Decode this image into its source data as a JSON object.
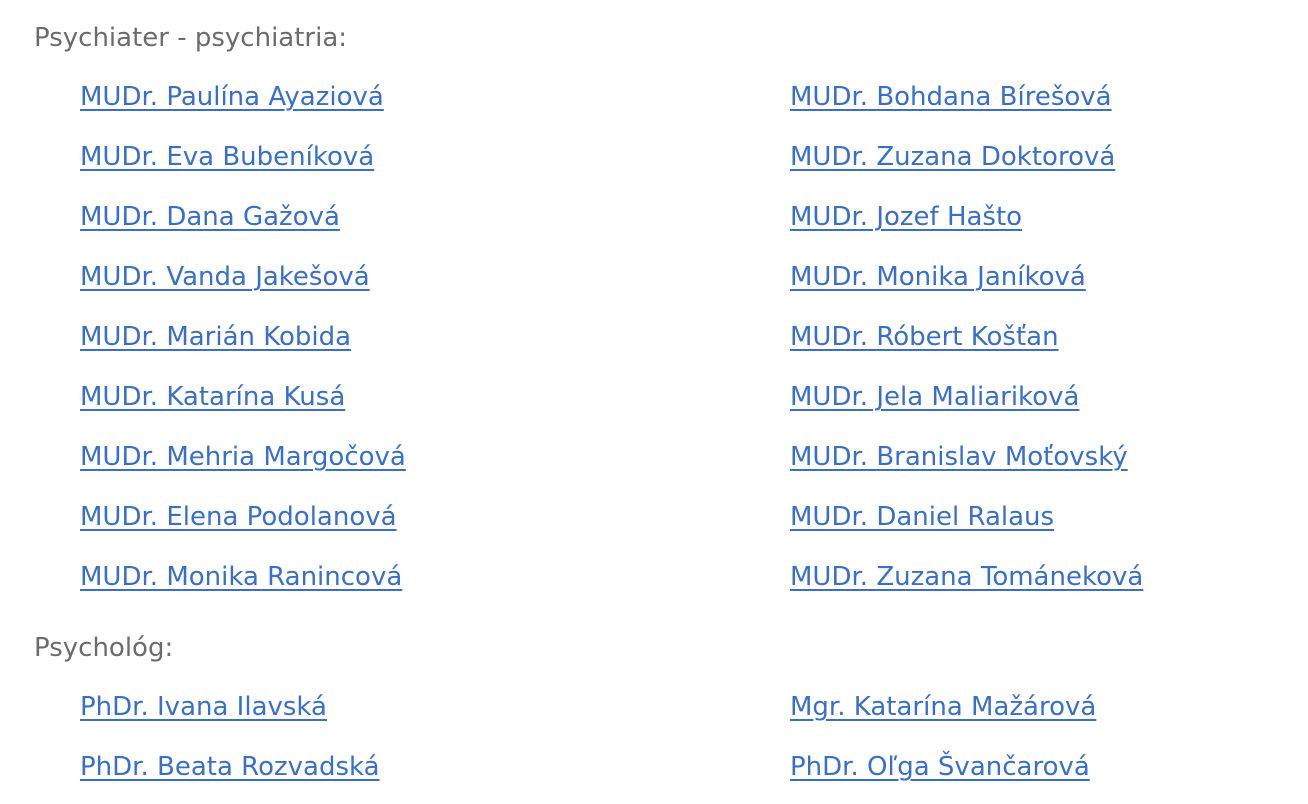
{
  "sections": [
    {
      "heading": "Psychiater - psychiatria:",
      "doctors": [
        "MUDr. Paulína Ayaziová",
        "MUDr. Bohdana Bírešová",
        "MUDr. Eva Bubeníková",
        "MUDr. Zuzana Doktorová",
        "MUDr. Dana Gažová",
        "MUDr. Jozef Hašto",
        "MUDr. Vanda Jakešová",
        "MUDr. Monika Janíková",
        "MUDr. Marián Kobida",
        "MUDr. Róbert Košťan",
        "MUDr. Katarína Kusá",
        "MUDr. Jela Maliariková",
        "MUDr. Mehria Margočová",
        "MUDr. Branislav Moťovský",
        "MUDr. Elena Podolanová",
        "MUDr. Daniel Ralaus",
        "MUDr. Monika Ranincová",
        "MUDr. Zuzana Tománeková"
      ]
    },
    {
      "heading": "Psychológ:",
      "doctors": [
        "PhDr. Ivana Ilavská",
        "Mgr. Katarína Mažárová",
        "PhDr. Beata Rozvadská",
        "PhDr. Oľga Švančarová"
      ]
    }
  ],
  "colors": {
    "link": "#3a6fc2",
    "heading": "#6b6b6b",
    "background": "#ffffff"
  }
}
